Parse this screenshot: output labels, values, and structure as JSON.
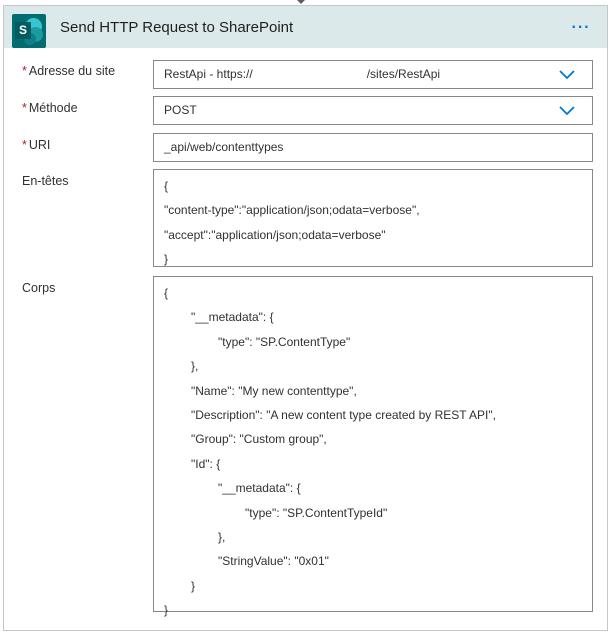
{
  "header": {
    "title": "Send HTTP Request to SharePoint",
    "icon": "sharepoint-icon",
    "logo_letter": "S",
    "more_label": "···",
    "background": "#dbe9ea"
  },
  "form": {
    "site_address": {
      "label": "Adresse du site",
      "required": true,
      "value_prefix": "RestApi - https://",
      "value_suffix": "/sites/RestApi"
    },
    "method": {
      "label": "Méthode",
      "required": true,
      "value": "POST"
    },
    "uri": {
      "label": "URI",
      "required": true,
      "value": "_api/web/contenttypes"
    },
    "headers": {
      "label": "En-têtes",
      "lines": [
        "{",
        "\"content-type\":\"application/json;odata=verbose\",",
        "\"accept\":\"application/json;odata=verbose\"",
        "}"
      ]
    },
    "body": {
      "label": "Corps",
      "lines": [
        "{",
        "\"__metadata\": {",
        "\"type\": \"SP.ContentType\"",
        "},",
        "\"Name\": \"My new contenttype\",",
        "\"Description\": \"A new content type created by REST API\",",
        "\"Group\": \"Custom group\",",
        "\"Id\": {",
        "\"__metadata\": {",
        "\"type\": \"SP.ContentTypeId\"",
        "},",
        "\"StringValue\": \"0x01\"",
        "}",
        "}"
      ]
    },
    "required_marker": "*"
  },
  "colors": {
    "accent": "#0078d4",
    "required": "#a4262c",
    "sharepoint": "#036c70"
  }
}
